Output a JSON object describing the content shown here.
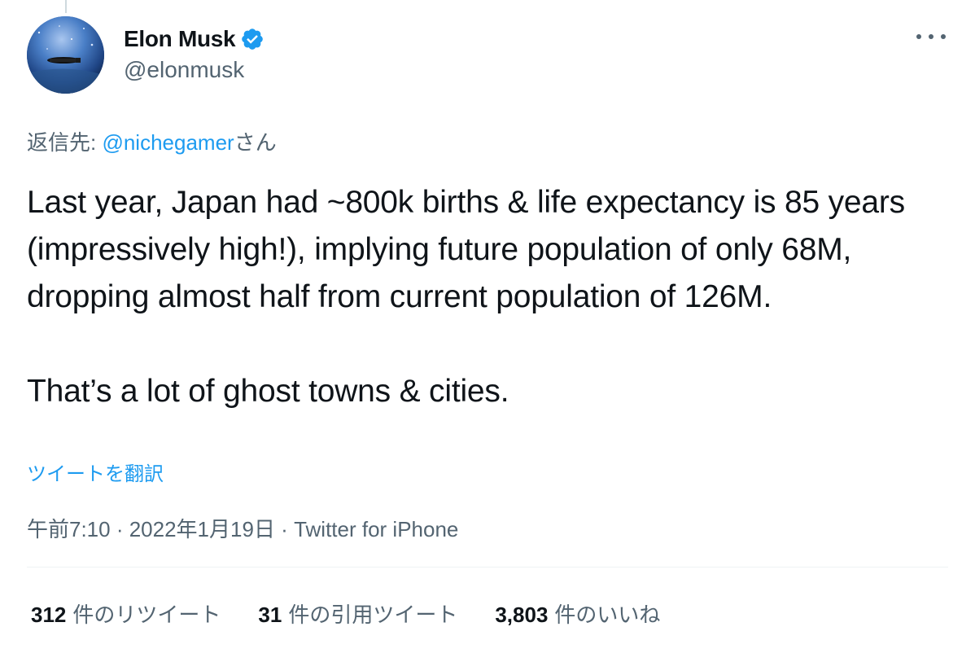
{
  "author": {
    "display_name": "Elon Musk",
    "handle": "@elonmusk",
    "verified": true,
    "verified_icon": "verified-badge-icon",
    "avatar_icon": "space-station-avatar"
  },
  "reply_to": {
    "prefix": "返信先: ",
    "mention": "@nichegamer",
    "suffix": "さん"
  },
  "tweet": {
    "paragraph_1": "Last year, Japan had ~800k births & life expectancy is 85 years (impressively high!), implying future population of only 68M, dropping almost half from current population of 126M.",
    "paragraph_2": "That’s a lot of ghost towns & cities."
  },
  "translate_label": "ツイートを翻訳",
  "meta": {
    "time": "午前7:10",
    "separator": " · ",
    "date": "2022年1月19日",
    "source": "Twitter for iPhone"
  },
  "stats": {
    "retweets_count": "312",
    "retweets_label": "件のリツイート",
    "quotes_count": "31",
    "quotes_label": "件の引用ツイート",
    "likes_count": "3,803",
    "likes_label": "件のいいね"
  },
  "colors": {
    "accent": "#1d9bf0",
    "text": "#0f1419",
    "secondary": "#536471"
  }
}
